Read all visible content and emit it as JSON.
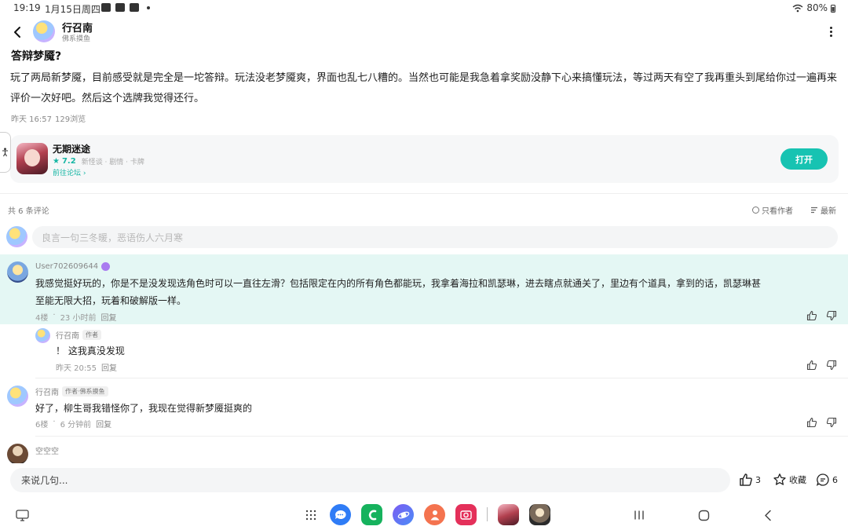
{
  "status_bar": {
    "time": "19:19",
    "date": "1月15日周四",
    "battery": "80%"
  },
  "header": {
    "user_name": "行召南",
    "user_subtitle": "佛系摸鱼"
  },
  "post": {
    "title": "答辩梦魇?",
    "body": "玩了两局新梦魇，目前感受就是完全是一坨答辩。玩法没老梦魇爽，界面也乱七八糟的。当然也可能是我急着拿奖励没静下心来搞懂玩法，等过两天有空了我再重头到尾给你过一遍再来评价一次好吧。然后这个选牌我觉得还行。",
    "time": "昨天 16:57",
    "views": "129浏览"
  },
  "game_card": {
    "name": "无期迷途",
    "rating": "7.2",
    "tags": "新怪谈 · 剧情 · 卡牌",
    "forum_link": "前往论坛",
    "open_button": "打开"
  },
  "comments_header": {
    "count": "共 6 条评论",
    "only_author": "只看作者",
    "sort": "最新"
  },
  "comment_input": {
    "placeholder": "良言一句三冬暖，恶语伤人六月寒"
  },
  "comments": [
    {
      "user": "User702609644",
      "text_line1": "我感觉挺好玩的，你是不是没发现选角色时可以一直往左滑？包括限定在内的所有角色都能玩，我拿着海拉和凯瑟琳，进去瞎点就通关了，里边有个道具，拿到的话，凯瑟琳甚",
      "text_line2": "至能无限大招，玩着和破解版一样。",
      "floor": "4楼",
      "time": "23 小时前",
      "reply": "回复",
      "replies": [
        {
          "user": "行召南",
          "tag": "作者",
          "text": "！ 这我真没发现",
          "time": "昨天 20:55",
          "reply": "回复"
        }
      ]
    },
    {
      "user": "行召南",
      "tag": "作者·佛系摸鱼",
      "text": "好了，柳生哥我错怪你了，我现在觉得新梦魇挺爽的",
      "floor": "6楼",
      "time": "6 分钟前",
      "reply": "回复"
    },
    {
      "user": "空空空"
    }
  ],
  "bottom_bar": {
    "placeholder": "来说几句...",
    "likes": "3",
    "favorite": "收藏",
    "comments": "6"
  },
  "colors": {
    "accent": "#17c3b2",
    "highlight_bg": "#e4f7f4",
    "text_primary": "#222222",
    "text_secondary": "#888888"
  }
}
